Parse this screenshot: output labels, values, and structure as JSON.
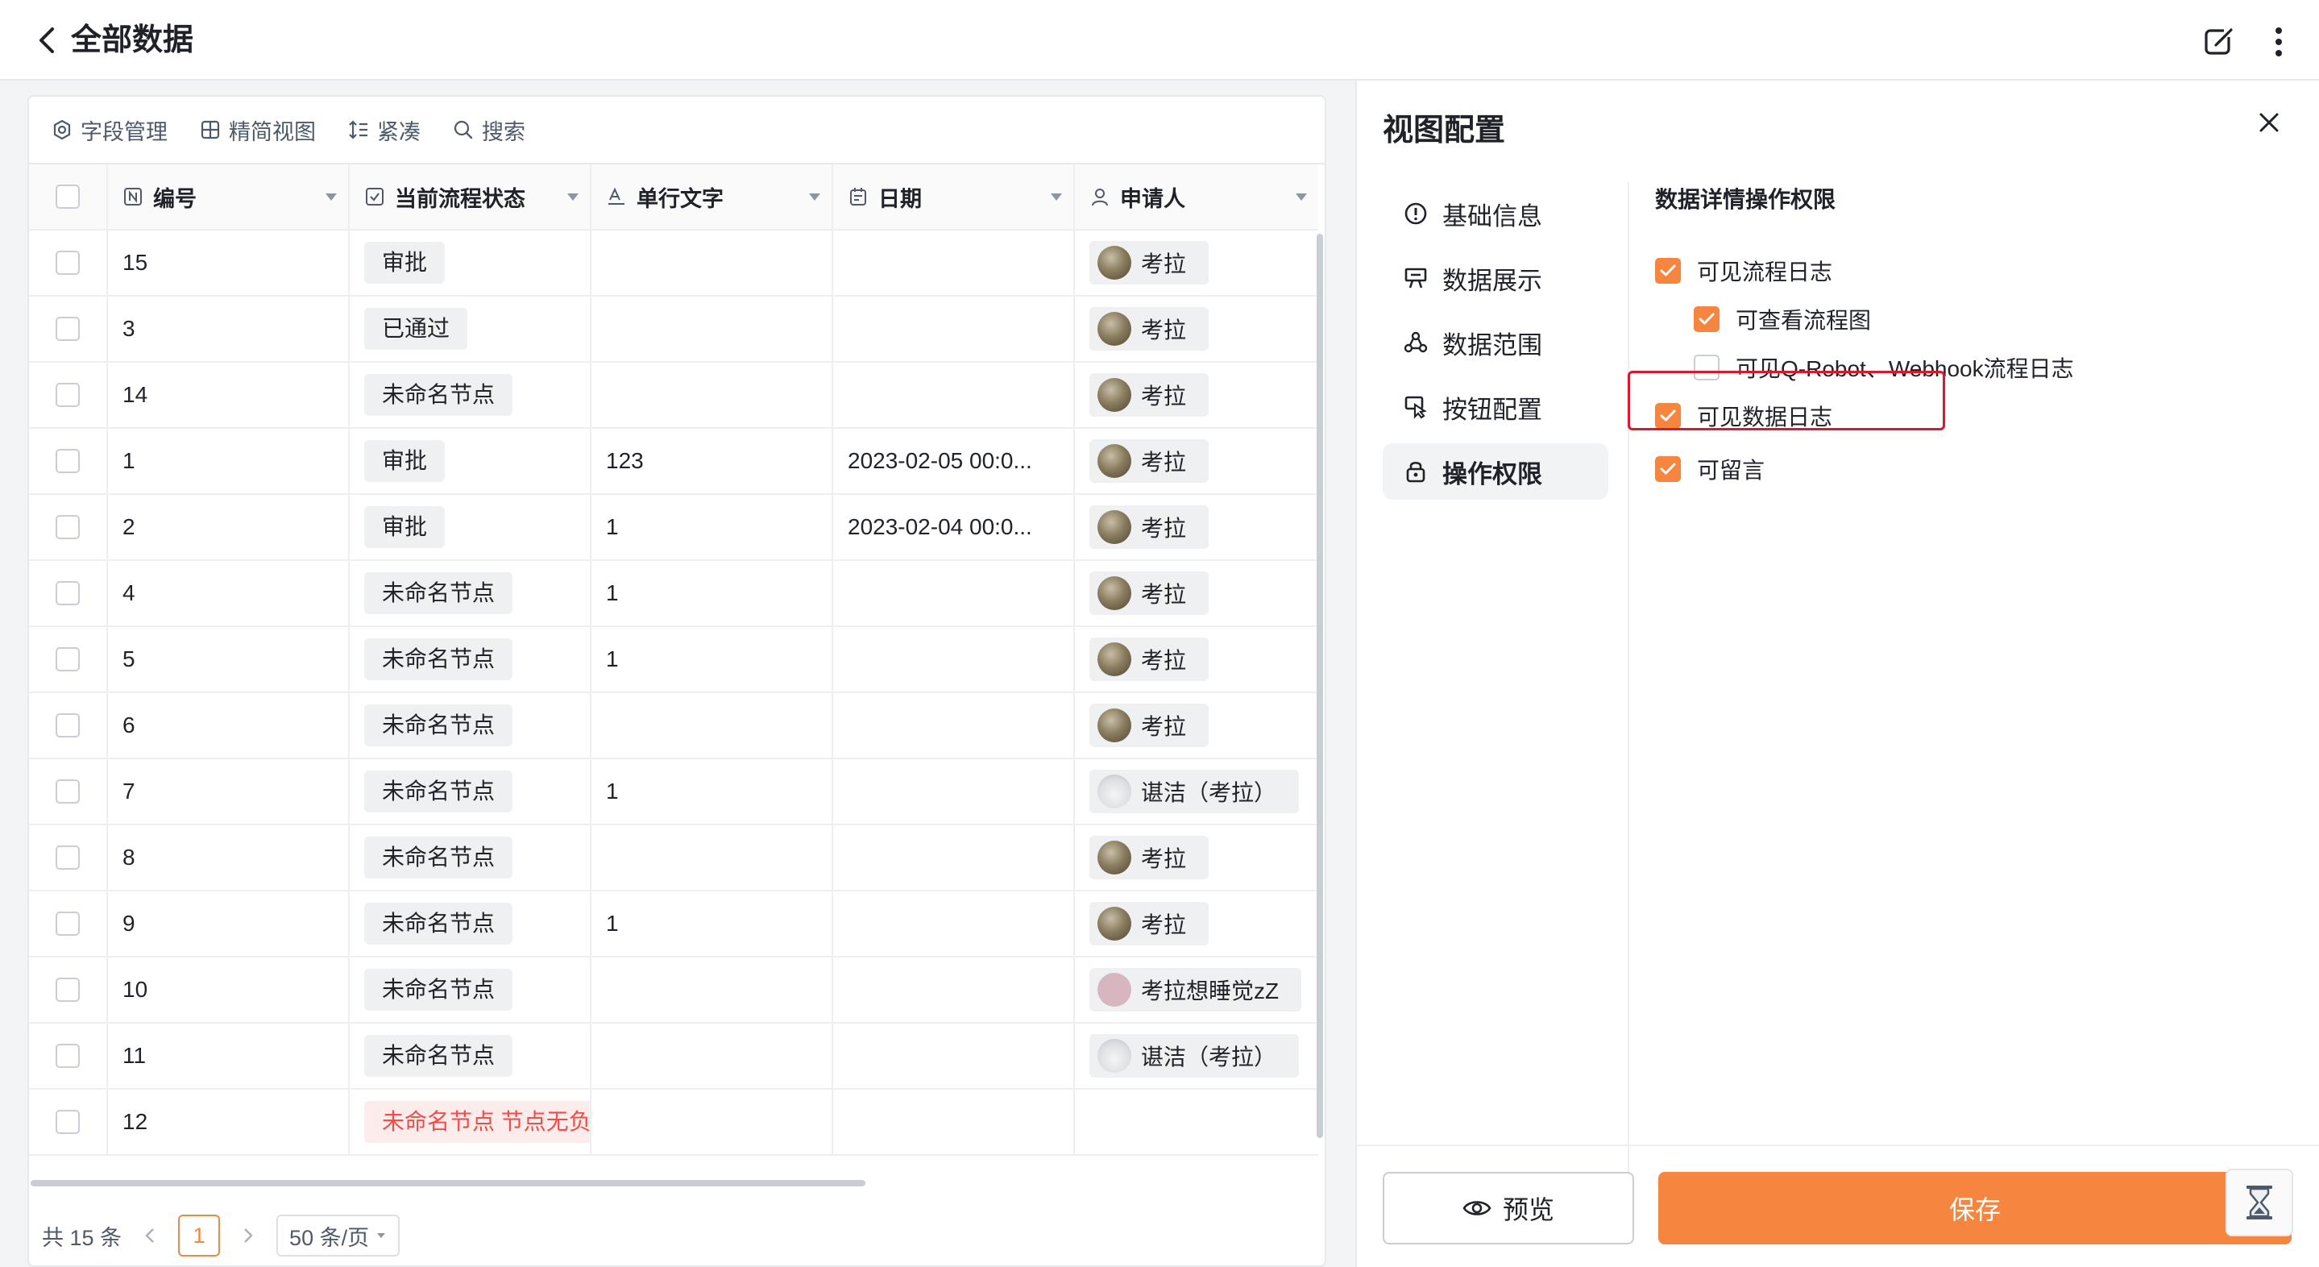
{
  "header": {
    "title": "全部数据"
  },
  "toolbar": [
    {
      "label": "字段管理",
      "icon": "settings-icon"
    },
    {
      "label": "精简视图",
      "icon": "grid-icon"
    },
    {
      "label": "紧凑",
      "icon": "line-height-icon"
    },
    {
      "label": "搜索",
      "icon": "search-icon"
    }
  ],
  "table": {
    "columns": [
      {
        "label": "编号",
        "icon": "number-field-icon"
      },
      {
        "label": "当前流程状态",
        "icon": "checkbox-field-icon"
      },
      {
        "label": "单行文字",
        "icon": "text-field-icon"
      },
      {
        "label": "日期",
        "icon": "calendar-icon"
      },
      {
        "label": "申请人",
        "icon": "user-icon"
      }
    ],
    "rows": [
      {
        "id": "15",
        "status": "审批",
        "text": "",
        "date": "",
        "applicant": "考拉",
        "avatar": "photo",
        "status_error": false
      },
      {
        "id": "3",
        "status": "已通过",
        "text": "",
        "date": "",
        "applicant": "考拉",
        "avatar": "photo",
        "status_error": false
      },
      {
        "id": "14",
        "status": "未命名节点",
        "text": "",
        "date": "",
        "applicant": "考拉",
        "avatar": "photo",
        "status_error": false
      },
      {
        "id": "1",
        "status": "审批",
        "text": "123",
        "date": "2023-02-05 00:0...",
        "applicant": "考拉",
        "avatar": "photo",
        "status_error": false
      },
      {
        "id": "2",
        "status": "审批",
        "text": "1",
        "date": "2023-02-04 00:0...",
        "applicant": "考拉",
        "avatar": "photo",
        "status_error": false
      },
      {
        "id": "4",
        "status": "未命名节点",
        "text": "1",
        "date": "",
        "applicant": "考拉",
        "avatar": "photo",
        "status_error": false
      },
      {
        "id": "5",
        "status": "未命名节点",
        "text": "1",
        "date": "",
        "applicant": "考拉",
        "avatar": "photo",
        "status_error": false
      },
      {
        "id": "6",
        "status": "未命名节点",
        "text": "",
        "date": "",
        "applicant": "考拉",
        "avatar": "photo",
        "status_error": false
      },
      {
        "id": "7",
        "status": "未命名节点",
        "text": "1",
        "date": "",
        "applicant": "谌洁（考拉）",
        "avatar": "cloud",
        "status_error": false
      },
      {
        "id": "8",
        "status": "未命名节点",
        "text": "",
        "date": "",
        "applicant": "考拉",
        "avatar": "photo",
        "status_error": false
      },
      {
        "id": "9",
        "status": "未命名节点",
        "text": "1",
        "date": "",
        "applicant": "考拉",
        "avatar": "photo",
        "status_error": false
      },
      {
        "id": "10",
        "status": "未命名节点",
        "text": "",
        "date": "",
        "applicant": "考拉想睡觉zZ",
        "avatar": "pink",
        "status_error": false
      },
      {
        "id": "11",
        "status": "未命名节点",
        "text": "",
        "date": "",
        "applicant": "谌洁（考拉）",
        "avatar": "cloud",
        "status_error": false
      },
      {
        "id": "12",
        "status": "未命名节点 节点无负",
        "text": "",
        "date": "",
        "applicant": "",
        "avatar": "none",
        "status_error": true
      }
    ]
  },
  "pagination": {
    "total": "共 15 条",
    "page": "1",
    "page_size": "50 条/页"
  },
  "panel": {
    "title": "视图配置",
    "nav": [
      {
        "label": "基础信息",
        "icon": "info-icon",
        "active": false
      },
      {
        "label": "数据展示",
        "icon": "display-icon",
        "active": false
      },
      {
        "label": "数据范围",
        "icon": "range-icon",
        "active": false
      },
      {
        "label": "按钮配置",
        "icon": "button-config-icon",
        "active": false
      },
      {
        "label": "操作权限",
        "icon": "lock-icon",
        "active": true
      }
    ],
    "section_title": "数据详情操作权限",
    "options": [
      {
        "label": "可见流程日志",
        "checked": true,
        "indent": false
      },
      {
        "label": "可查看流程图",
        "checked": true,
        "indent": true
      },
      {
        "label": "可见Q-Robot、Webhook流程日志",
        "checked": false,
        "indent": true
      },
      {
        "label": "可见数据日志",
        "checked": true,
        "indent": false,
        "highlighted": true
      },
      {
        "label": "可留言",
        "checked": true,
        "indent": false
      }
    ],
    "preview_label": "预览",
    "save_label": "保存"
  },
  "colors": {
    "accent": "#f5853f",
    "highlight_border": "#e2152a",
    "error_text": "#f54a45"
  }
}
